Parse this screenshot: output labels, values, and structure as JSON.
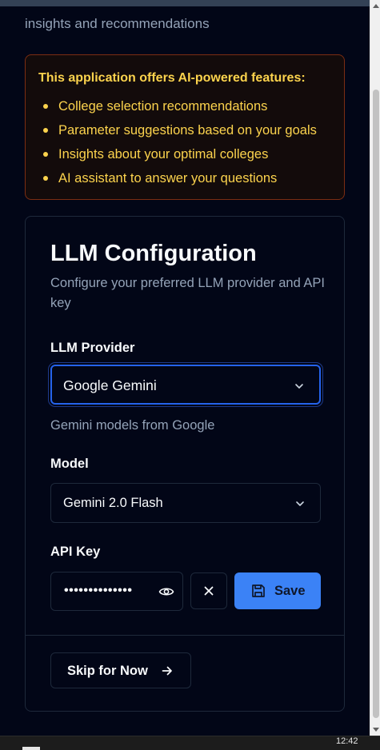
{
  "intro": {
    "clipped_line": "insights and recommendations"
  },
  "notice": {
    "title": "This application offers AI-powered features:",
    "items": [
      "College selection recommendations",
      "Parameter suggestions based on your goals",
      "Insights about your optimal colleges",
      "AI assistant to answer your questions"
    ]
  },
  "llm_config": {
    "title": "LLM Configuration",
    "subtitle": "Configure your preferred LLM provider and API key",
    "provider_label": "LLM Provider",
    "provider_value": "Google Gemini",
    "provider_hint": "Gemini models from Google",
    "model_label": "Model",
    "model_value": "Gemini 2.0 Flash",
    "api_key_label": "API Key",
    "api_key_masked": "••••••••••••••",
    "save_label": "Save",
    "skip_label": "Skip for Now"
  },
  "taskbar": {
    "time": "12:42"
  },
  "colors": {
    "background": "#020617",
    "notice_text": "#fcd34d",
    "notice_border": "#7c2d12",
    "focus_ring": "#2563eb",
    "save_button": "#3b82f6",
    "muted_text": "#94a3b8"
  },
  "icons": [
    "chevron-down-icon",
    "eye-icon",
    "close-icon",
    "save-icon",
    "arrow-right-icon"
  ]
}
